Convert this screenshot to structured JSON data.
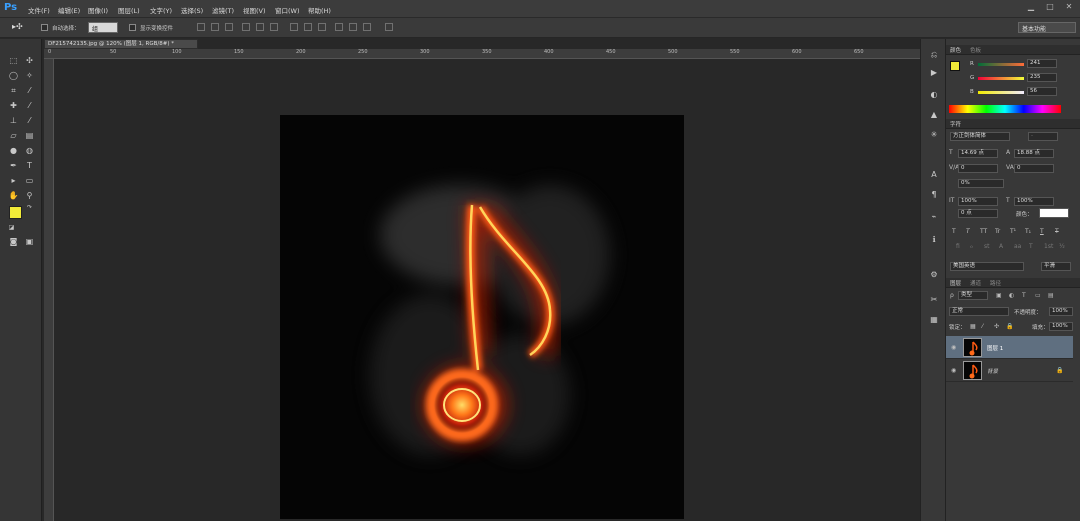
{
  "app": {
    "logo": "Ps"
  },
  "menu": [
    "文件(F)",
    "编辑(E)",
    "图像(I)",
    "图层(L)",
    "文字(Y)",
    "选择(S)",
    "滤镜(T)",
    "视图(V)",
    "窗口(W)",
    "帮助(H)"
  ],
  "window_controls": {
    "minimize": "▁",
    "maximize": "□",
    "close": "✕"
  },
  "options": {
    "auto_select_label": "自动选择：",
    "auto_select_value": "组",
    "show_transform_label": "显示变换控件",
    "workspace": "基本功能"
  },
  "document": {
    "tab_title": "DF215742135.jpg @ 120% (图层 1, RGB/8#) *",
    "ruler_marks": [
      "0",
      "50",
      "100",
      "150",
      "200",
      "250",
      "300",
      "350",
      "400",
      "450",
      "500",
      "550",
      "600",
      "650"
    ]
  },
  "color_panel": {
    "tabs": [
      "颜色",
      "色板"
    ],
    "channels": [
      {
        "label": "R",
        "value": "241"
      },
      {
        "label": "G",
        "value": "235"
      },
      {
        "label": "B",
        "value": "56"
      }
    ],
    "foreground": "#f1eb38"
  },
  "character_panel": {
    "tab": "字符",
    "font_family": "方正剑体简体",
    "font_style": "-",
    "font_size": "14.69 点",
    "leading": "18.88 点",
    "kerning": "0",
    "tracking": "0",
    "scale_pct": "0%",
    "vscale": "100%",
    "hscale": "100%",
    "baseline": "0 点",
    "color_label": "颜色：",
    "styles": [
      "T",
      "T",
      "TT",
      "Tr",
      "T¹",
      "T₁",
      "T",
      "T"
    ],
    "opentype": [
      "fi",
      "ℴ",
      "st",
      "A",
      "aa",
      "T",
      "1st",
      "½"
    ],
    "language": "美国英语",
    "antialias": "平滑"
  },
  "layers_panel": {
    "tabs": [
      "图层",
      "通道",
      "路径"
    ],
    "filter": "类型",
    "blend_mode": "正常",
    "opacity_label": "不透明度：",
    "opacity": "100%",
    "lock_label": "锁定：",
    "fill_label": "填充：",
    "fill": "100%",
    "layers": [
      {
        "name": "图层 1",
        "selected": true
      },
      {
        "name": "背景",
        "selected": false,
        "locked": true
      }
    ]
  },
  "colors": {
    "accent": "#39a0ff",
    "panel_bg": "#383838",
    "selected_layer": "#5f6f80"
  }
}
